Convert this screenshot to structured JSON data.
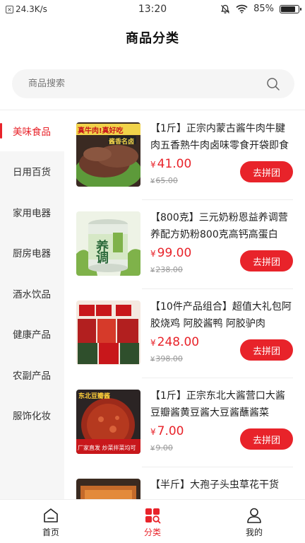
{
  "status_bar": {
    "network_speed": "24.3K/s",
    "time": "13:20",
    "battery": "85%",
    "battery_level": 0.85
  },
  "header": {
    "title": "商品分类"
  },
  "search": {
    "placeholder": "商品搜索",
    "value": ""
  },
  "sidebar": {
    "items": [
      {
        "label": "美味食品",
        "active": true
      },
      {
        "label": "日用百货",
        "active": false
      },
      {
        "label": "家用电器",
        "active": false
      },
      {
        "label": "厨房电器",
        "active": false
      },
      {
        "label": "酒水饮品",
        "active": false
      },
      {
        "label": "健康产品",
        "active": false
      },
      {
        "label": "农副产品",
        "active": false
      },
      {
        "label": "服饰化妆",
        "active": false
      }
    ]
  },
  "products": [
    {
      "title": "【1斤】正宗内蒙古酱牛肉牛腱肉五香熟牛肉卤味零食开袋即食",
      "price_symbol": "¥",
      "price": "41.00",
      "original_price": "65.00",
      "button": "去拼团",
      "thumb_text_1": "真牛肉!真好吃",
      "thumb_text_2": "酱香名卤"
    },
    {
      "title": "【800克】三元奶粉恩益养调营养配方奶粉800克高钙高蛋白",
      "price_symbol": "¥",
      "price": "99.00",
      "original_price": "238.00",
      "button": "去拼团",
      "thumb_text_1": "养调",
      "thumb_text_2": ""
    },
    {
      "title": "【10件产品组合】超值大礼包阿胶烧鸡 阿胶酱鸭 阿胶驴肉",
      "price_symbol": "¥",
      "price": "248.00",
      "original_price": "398.00",
      "button": "去拼团",
      "thumb_text_1": "",
      "thumb_text_2": ""
    },
    {
      "title": "【1斤】正宗东北大酱营口大酱豆瓣酱黄豆酱大豆酱蘸酱菜",
      "price_symbol": "¥",
      "price": "7.00",
      "original_price": "9.00",
      "button": "去拼团",
      "thumb_text_1": "东北豆瓣酱",
      "thumb_text_2": "厂家直发 炒菜拌菜均可"
    },
    {
      "title": "【半斤】大孢子头虫草花干货",
      "price_symbol": "¥",
      "price": "",
      "original_price": "",
      "button": "",
      "thumb_text_1": "",
      "thumb_text_2": ""
    }
  ],
  "bottom_nav": {
    "items": [
      {
        "label": "首页",
        "active": false
      },
      {
        "label": "分类",
        "active": true
      },
      {
        "label": "我的",
        "active": false
      }
    ]
  },
  "colors": {
    "accent": "#e8232a",
    "sidebar_bg": "#f6f6f6",
    "search_bg": "#f5f5f5"
  }
}
